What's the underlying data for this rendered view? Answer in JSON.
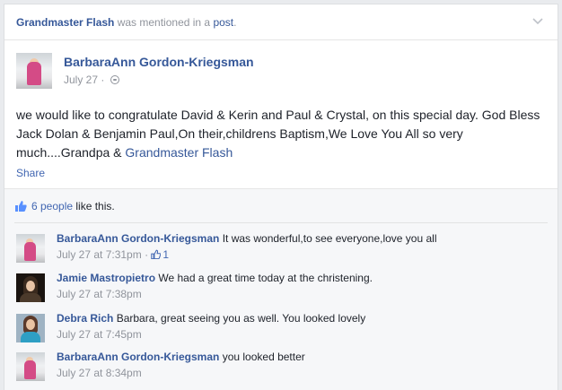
{
  "mention": {
    "subject": "Grandmaster Flash",
    "middle": " was mentioned in a ",
    "post_word": "post",
    "end": "."
  },
  "post": {
    "author": "BarbaraAnn Gordon-Kriegsman",
    "date": "July 27",
    "separator": " · ",
    "privacy_icon": "globe-icon",
    "text": "we would like to congratulate David & Kerin and Paul & Crystal, on this special day. God Bless Jack Dolan & Benjamin Paul,On their,childrens Baptism,We Love You All so very much....Grandpa & ",
    "tagged": "Grandmaster Flash",
    "share_label": "Share"
  },
  "likes": {
    "people": "6 people",
    "suffix": " like this."
  },
  "comments": [
    {
      "name": "BarbaraAnn Gordon-Kriegsman",
      "text": " It was wonderful,to see everyone,love you all",
      "time": "July 27 at 7:31pm",
      "sep": " · ",
      "like_count": "1"
    },
    {
      "name": "Jamie Mastropietro",
      "text": " We had a great time today at the christening.",
      "time": "July 27 at 7:38pm"
    },
    {
      "name": "Debra Rich",
      "text": " Barbara, great seeing you as well. You looked lovely",
      "time": "July 27 at 7:45pm"
    },
    {
      "name": "BarbaraAnn Gordon-Kriegsman",
      "text": " you looked better",
      "time": "July 27 at 8:34pm"
    }
  ],
  "colors": {
    "link": "#365899",
    "muted": "#90949c",
    "accent": "#4267b2"
  }
}
